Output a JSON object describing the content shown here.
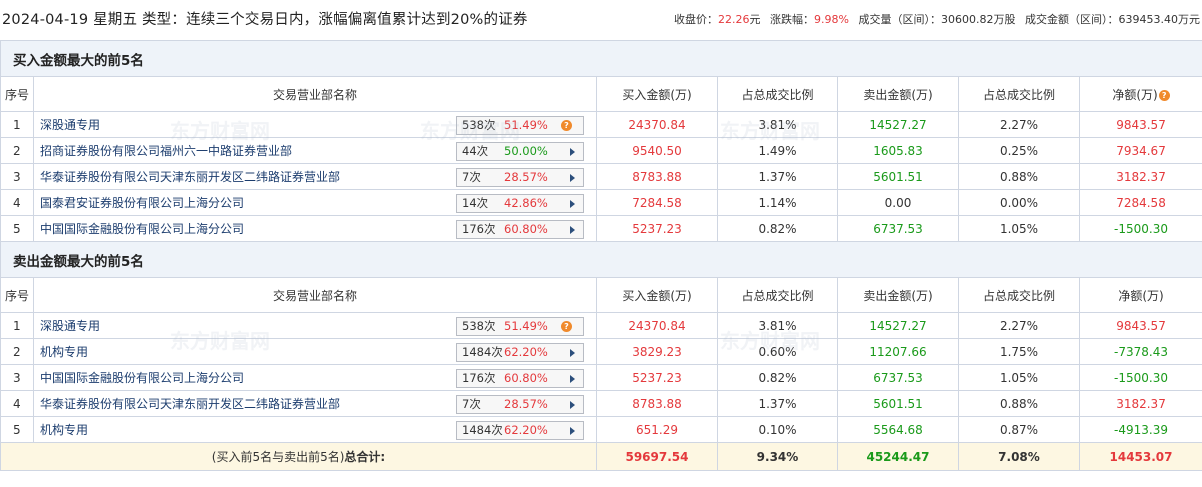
{
  "header": {
    "title": "2024-04-19 星期五 类型：连续三个交易日内，涨幅偏离值累计达到20%的证券",
    "close_label": "收盘价：",
    "close_value": "22.26",
    "close_unit": "元",
    "change_label": "涨跌幅：",
    "change_value": "9.98%",
    "volume_label": "成交量（区间）：",
    "volume_value": "30600.82万股",
    "amount_label": "成交金额（区间）：",
    "amount_value": "639453.40万元"
  },
  "buy_section": {
    "title": "买入金额最大的前5名",
    "columns": [
      "序号",
      "交易营业部名称",
      "买入金额(万)",
      "占总成交比例",
      "卖出金额(万)",
      "占总成交比例",
      "净额(万)"
    ],
    "net_hint_icon": "question-icon",
    "rows": [
      {
        "seq": "1",
        "name": "深股通专用",
        "count": "538次",
        "pct": "51.49%",
        "icon": "question-icon",
        "buy": "24370.84",
        "buy_ratio": "3.81%",
        "sell": "14527.27",
        "sell_ratio": "2.27%",
        "net": "9843.57"
      },
      {
        "seq": "2",
        "name": "招商证券股份有限公司福州六一中路证券营业部",
        "count": "44次",
        "pct": "50.00%",
        "icon": "arrow-right-icon",
        "buy": "9540.50",
        "buy_ratio": "1.49%",
        "sell": "1605.83",
        "sell_ratio": "0.25%",
        "net": "7934.67"
      },
      {
        "seq": "3",
        "name": "华泰证券股份有限公司天津东丽开发区二纬路证券营业部",
        "count": "7次",
        "pct": "28.57%",
        "icon": "arrow-right-icon",
        "buy": "8783.88",
        "buy_ratio": "1.37%",
        "sell": "5601.51",
        "sell_ratio": "0.88%",
        "net": "3182.37"
      },
      {
        "seq": "4",
        "name": "国泰君安证券股份有限公司上海分公司",
        "count": "14次",
        "pct": "42.86%",
        "icon": "arrow-right-icon",
        "buy": "7284.58",
        "buy_ratio": "1.14%",
        "sell": "0.00",
        "sell_ratio": "0.00%",
        "net": "7284.58"
      },
      {
        "seq": "5",
        "name": "中国国际金融股份有限公司上海分公司",
        "count": "176次",
        "pct": "60.80%",
        "icon": "arrow-right-icon",
        "buy": "5237.23",
        "buy_ratio": "0.82%",
        "sell": "6737.53",
        "sell_ratio": "1.05%",
        "net": "-1500.30"
      }
    ]
  },
  "sell_section": {
    "title": "卖出金额最大的前5名",
    "columns": [
      "序号",
      "交易营业部名称",
      "买入金额(万)",
      "占总成交比例",
      "卖出金额(万)",
      "占总成交比例",
      "净额(万)"
    ],
    "rows": [
      {
        "seq": "1",
        "name": "深股通专用",
        "count": "538次",
        "pct": "51.49%",
        "icon": "question-icon",
        "buy": "24370.84",
        "buy_ratio": "3.81%",
        "sell": "14527.27",
        "sell_ratio": "2.27%",
        "net": "9843.57"
      },
      {
        "seq": "2",
        "name": "机构专用",
        "count": "1484次",
        "pct": "62.20%",
        "icon": "arrow-right-icon",
        "buy": "3829.23",
        "buy_ratio": "0.60%",
        "sell": "11207.66",
        "sell_ratio": "1.75%",
        "net": "-7378.43"
      },
      {
        "seq": "3",
        "name": "中国国际金融股份有限公司上海分公司",
        "count": "176次",
        "pct": "60.80%",
        "icon": "arrow-right-icon",
        "buy": "5237.23",
        "buy_ratio": "0.82%",
        "sell": "6737.53",
        "sell_ratio": "1.05%",
        "net": "-1500.30"
      },
      {
        "seq": "4",
        "name": "华泰证券股份有限公司天津东丽开发区二纬路证券营业部",
        "count": "7次",
        "pct": "28.57%",
        "icon": "arrow-right-icon",
        "buy": "8783.88",
        "buy_ratio": "1.37%",
        "sell": "5601.51",
        "sell_ratio": "0.88%",
        "net": "3182.37"
      },
      {
        "seq": "5",
        "name": "机构专用",
        "count": "1484次",
        "pct": "62.20%",
        "icon": "arrow-right-icon",
        "buy": "651.29",
        "buy_ratio": "0.10%",
        "sell": "5564.68",
        "sell_ratio": "0.87%",
        "net": "-4913.39"
      }
    ],
    "total": {
      "label_prefix": "(买入前5名与卖出前5名)",
      "label_bold": "总合计:",
      "buy": "59697.54",
      "buy_ratio": "9.34%",
      "sell": "45244.47",
      "sell_ratio": "7.08%",
      "net": "14453.07"
    }
  },
  "watermark": {
    "cn": "东方财富网",
    "en": "eastmoney.com"
  },
  "colors": {
    "positive": "#e4393c",
    "negative": "#1a9a1a",
    "header_bg": "#eef3f9",
    "total_bg": "#fdf7e2",
    "border": "#cfd6e2"
  }
}
